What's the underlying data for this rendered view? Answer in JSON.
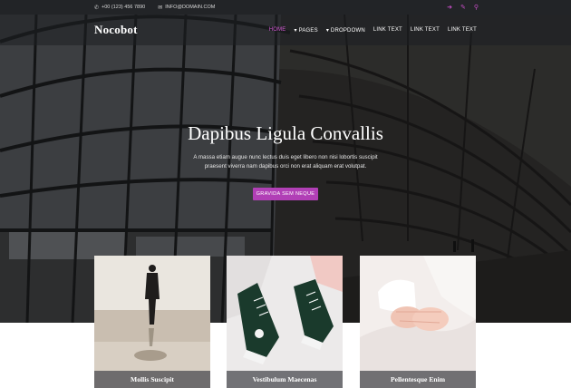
{
  "topbar": {
    "phone": "+00 (123) 456 7890",
    "email": "INFO@DOMAIN.COM",
    "icons": [
      "login-icon",
      "edit-icon",
      "search-icon"
    ]
  },
  "nav": {
    "brand": "Nocobot",
    "items": [
      {
        "label": "HOME"
      },
      {
        "label": "PAGES"
      },
      {
        "label": "DROPDOWN"
      },
      {
        "label": "LINK TEXT"
      },
      {
        "label": "LINK TEXT"
      },
      {
        "label": "LINK TEXT"
      }
    ]
  },
  "hero": {
    "title": "Dapibus Ligula Convallis",
    "subtitle": "A massa etiam augue nunc lectus duis eget libero non nisi lobortis suscipit praesent viverra nam dapibus orci non erat aliquam erat volutpat.",
    "button": "GRAVIDA SEM NEQUE"
  },
  "cards": [
    {
      "title": "Mollis Suscipit"
    },
    {
      "title": "Vestibulum Maecenas"
    },
    {
      "title": "Pellentesque Enim"
    }
  ],
  "colors": {
    "accent": "#b13fb6",
    "active_link": "#d35ad3",
    "topbar": "#222427"
  }
}
